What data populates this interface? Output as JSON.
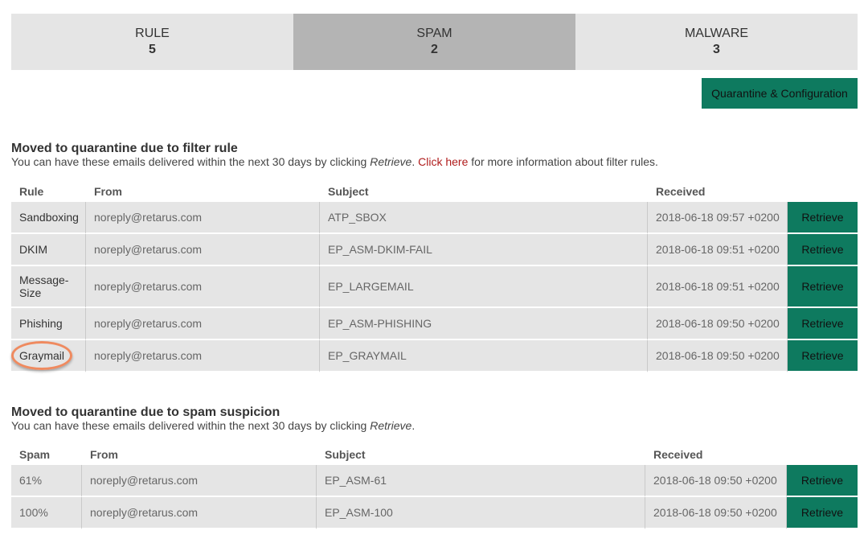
{
  "tabs": [
    {
      "label": "RULE",
      "count": "5"
    },
    {
      "label": "SPAM",
      "count": "2"
    },
    {
      "label": "MALWARE",
      "count": "3"
    }
  ],
  "config_button": "Quarantine & Configuration",
  "filter_section": {
    "title": "Moved to quarantine due to filter rule",
    "desc_before": "You can have these emails delivered within the next 30 days by clicking ",
    "desc_italic": "Retrieve",
    "desc_mid": ". ",
    "link": "Click here",
    "desc_after": " for more information about filter rules.",
    "headers": {
      "rule": "Rule",
      "from": "From",
      "subject": "Subject",
      "received": "Received"
    },
    "rows": [
      {
        "rule": "Sandboxing",
        "from": "noreply@retarus.com",
        "subject": "ATP_SBOX",
        "received": "2018-06-18 09:57 +0200",
        "action": "Retrieve"
      },
      {
        "rule": "DKIM",
        "from": "noreply@retarus.com",
        "subject": "EP_ASM-DKIM-FAIL",
        "received": "2018-06-18 09:51 +0200",
        "action": "Retrieve"
      },
      {
        "rule": "Message-Size",
        "from": "noreply@retarus.com",
        "subject": "EP_LARGEMAIL",
        "received": "2018-06-18 09:51 +0200",
        "action": "Retrieve"
      },
      {
        "rule": "Phishing",
        "from": "noreply@retarus.com",
        "subject": "EP_ASM-PHISHING",
        "received": "2018-06-18 09:50 +0200",
        "action": "Retrieve"
      },
      {
        "rule": "Graymail",
        "from": "noreply@retarus.com",
        "subject": "EP_GRAYMAIL",
        "received": "2018-06-18 09:50 +0200",
        "action": "Retrieve"
      }
    ]
  },
  "spam_section": {
    "title": "Moved to quarantine due to spam suspicion",
    "desc_before": "You can have these emails delivered within the next 30 days by clicking ",
    "desc_italic": "Retrieve",
    "desc_after": ".",
    "headers": {
      "spam": "Spam",
      "from": "From",
      "subject": "Subject",
      "received": "Received"
    },
    "rows": [
      {
        "spam": "61%",
        "from": "noreply@retarus.com",
        "subject": "EP_ASM-61",
        "received": "2018-06-18 09:50 +0200",
        "action": "Retrieve"
      },
      {
        "spam": "100%",
        "from": "noreply@retarus.com",
        "subject": "EP_ASM-100",
        "received": "2018-06-18 09:50 +0200",
        "action": "Retrieve"
      }
    ]
  },
  "colors": {
    "accent": "#0e7a5f",
    "tab_active": "#b4b4b4",
    "tab_inactive": "#e5e5e5",
    "link": "#b01c1c",
    "highlight": "#ef8a5f"
  }
}
